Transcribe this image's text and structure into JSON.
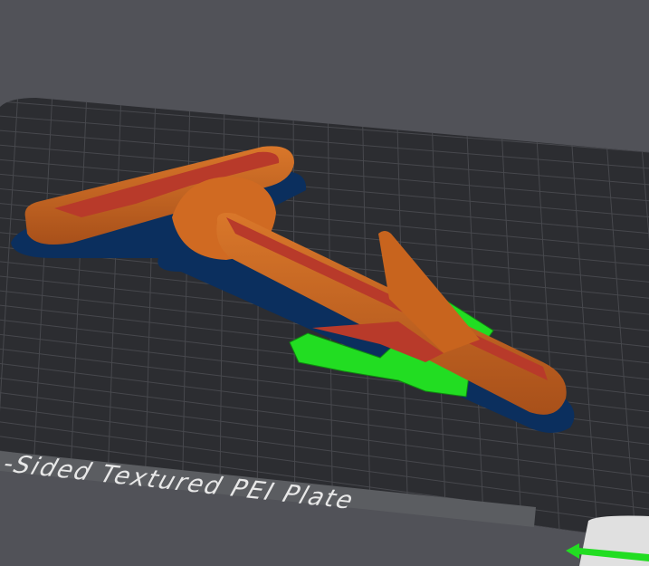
{
  "viewport": {
    "plate_label": "-Sided Textured PEI Plate",
    "colors": {
      "background": "#515258",
      "plate": "#2c2d31",
      "grid": "#45464b",
      "filament": "#c8641e",
      "top_surface": "#b83a2a",
      "support": "#22dd22",
      "shadow": "#0b2f5e"
    }
  }
}
